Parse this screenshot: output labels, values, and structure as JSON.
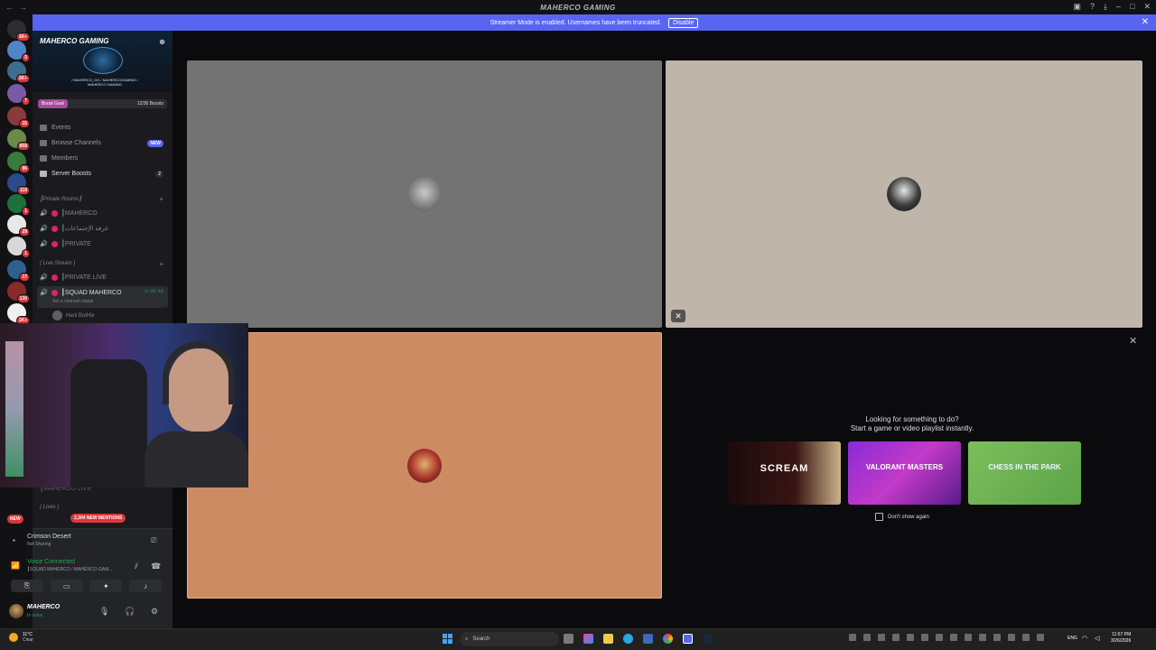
{
  "titlebar": {
    "title": "MAHERCO GAMING"
  },
  "banner": {
    "text": "Streamer Mode is enabled. Usernames have been truncated.",
    "disable_label": "Disable"
  },
  "server_badges": [
    "1K+",
    "5",
    "2K+",
    "7",
    "15",
    "858",
    "96",
    "118",
    "1",
    "29",
    "1",
    "17",
    "130",
    "1K+"
  ],
  "guild": {
    "name": "MAHERCO GAMING",
    "logo_text": "/ MAHERCO_GG / MAHERCOGAMING / MAHERCO GAMING",
    "boost_goal_label": "Boost Goal",
    "boost_count": "12/36 Boosts"
  },
  "nav": {
    "events": "Events",
    "browse": "Browse Channels",
    "browse_badge": "NEW",
    "members": "Members",
    "boosts": "Server Boosts",
    "boosts_count": "2"
  },
  "categories": {
    "private": "┃Private Rooms┃",
    "live": "( Live Stream )",
    "lives": "( Lives )"
  },
  "channels": {
    "maherco": "┃MAHERCO",
    "arabic": "┃غرفة الإجتماعات",
    "private": "┃PRIVATE",
    "private_live": "┃PRIVATE LIVE",
    "squad": "┃SQUAD MAHERCO",
    "squad_timer": "3:28:16",
    "squad_status": "Set a channel status",
    "member": "Hani BotHix",
    "maherco_live": "┃MAHERCO LIVE"
  },
  "mentions": "2,304 NEW MENTIONS",
  "new_pill": "NEW",
  "game": {
    "title": "Crimson Desert",
    "sub": "Not Sharing"
  },
  "voice": {
    "title": "Voice Connected",
    "sub": "┃SQUAD MAHERCO / MAHERCO GAM..."
  },
  "user": {
    "name": "MAHERCO",
    "status": "In voice"
  },
  "activity": {
    "line1": "Looking for something to do?",
    "line2": "Start a game or video playlist instantly.",
    "cards": [
      "SCREAM",
      "VALORANT MASTERS",
      "CHESS IN THE PARK"
    ],
    "dont_show": "Don't show again"
  },
  "taskbar": {
    "weather_temp": "11°C",
    "weather_cond": "Clear",
    "search": "Search",
    "lang": "ENG",
    "time": "11:57 PM",
    "date": "3/26/2026"
  },
  "colors": {
    "blurple": "#5865f2",
    "tile_gray": "#737373",
    "tile_beige": "#c0b5ab",
    "tile_orange": "#cd8b63",
    "green": "#23a55a",
    "red": "#da373c"
  }
}
